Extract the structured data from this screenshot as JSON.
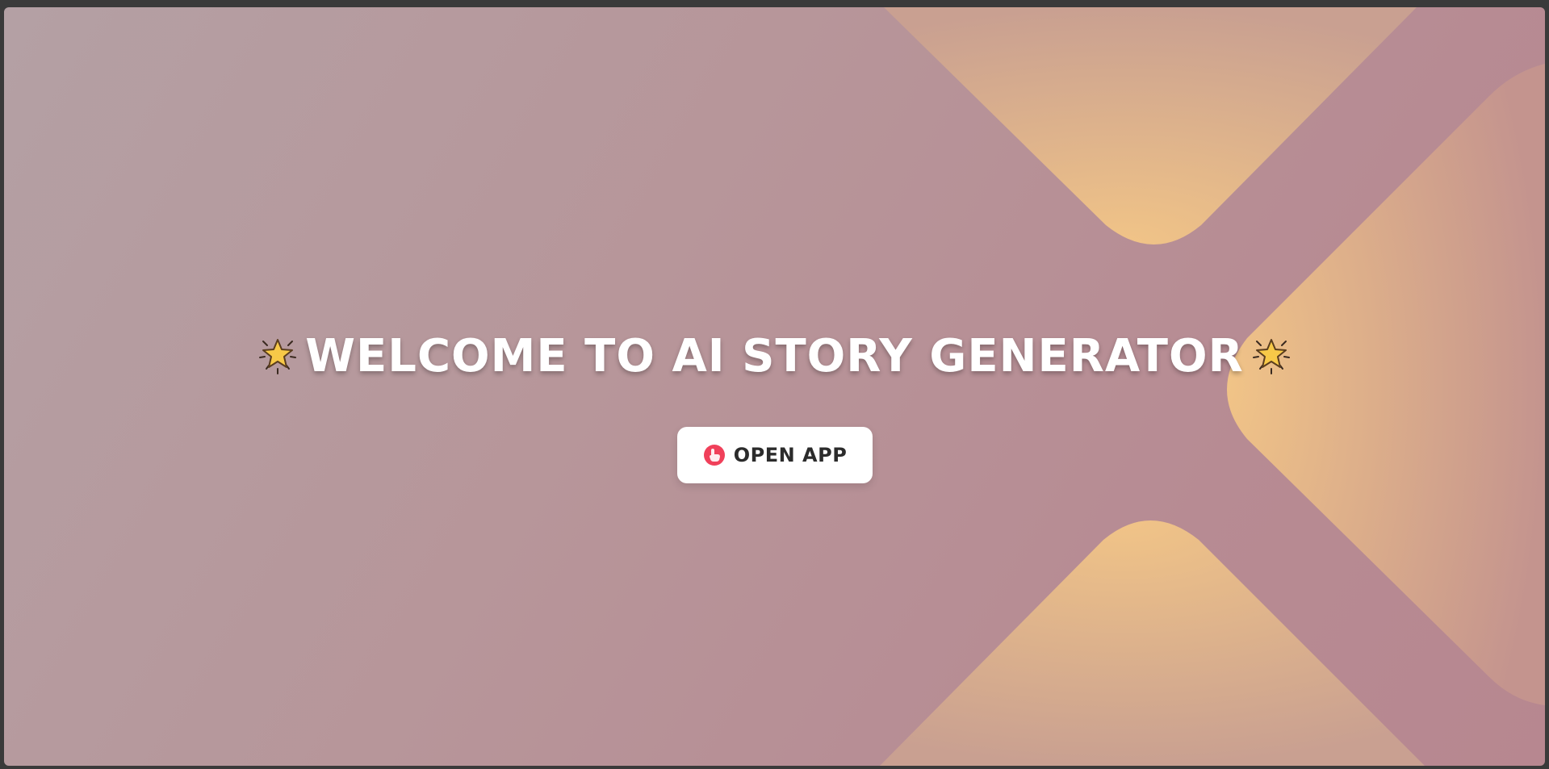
{
  "hero": {
    "title": "WELCOME TO AI STORY GENERATOR",
    "open_button_label": "OPEN APP",
    "title_icon": "glowing-star-icon",
    "button_icon": "pointing-hand-icon"
  },
  "colors": {
    "background_start": "#b4a0a4",
    "background_end": "#b78790",
    "accent_shape": "#f1c487",
    "title_text": "#ffffff",
    "button_bg": "#ffffff",
    "button_text": "#2b2b2b",
    "button_icon": "#f0405a"
  }
}
